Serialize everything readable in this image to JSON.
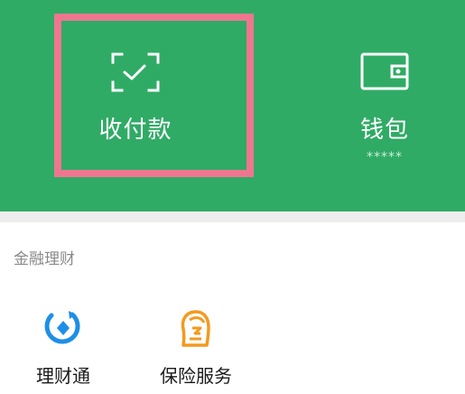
{
  "wallet_menu": {
    "pay_label": "收付款",
    "pay_icon": "scan-check-icon",
    "wallet_label": "钱包",
    "wallet_icon": "wallet-icon",
    "wallet_balance_masked": "*****"
  },
  "finance": {
    "section_title": "金融理财",
    "items": [
      {
        "label": "理财通",
        "icon": "licaitong-icon"
      },
      {
        "label": "保险服务",
        "icon": "insurance-icon"
      }
    ]
  },
  "colors": {
    "header_green": "#2FAB65",
    "highlight_pink": "#F0768F",
    "separator_gray": "#EDEDED",
    "licaitong_blue": "#1E8FE6",
    "insurance_orange": "#F39A1E"
  }
}
